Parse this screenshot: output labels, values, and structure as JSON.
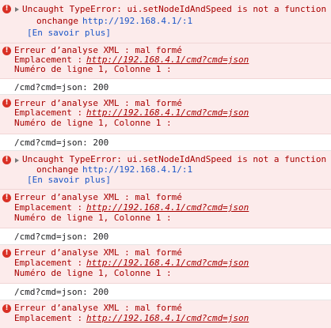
{
  "type_error": {
    "prefix": "Uncaught TypeError: ui.setNodeIdAndSpeed is not a function",
    "trace_fn": "onchange",
    "trace_url": "http://192.168.4.1/:1",
    "learn_more": "[En savoir plus]"
  },
  "xml_error": {
    "line1": "Erreur d’analyse XML : mal formé",
    "location_label": "Emplacement : ",
    "location_url": "http://192.168.4.1/cmd?cmd=json",
    "line3": "Numéro de ligne 1, Colonne 1 :"
  },
  "status_log": "/cmd?cmd=json: 200",
  "icons": {
    "error": "error-icon",
    "expand": "expand-triangle-icon"
  },
  "colors": {
    "error_bg": "#fcebeb",
    "error_text": "#a80000",
    "link": "#1a55c7",
    "error_icon": "#d93025"
  }
}
